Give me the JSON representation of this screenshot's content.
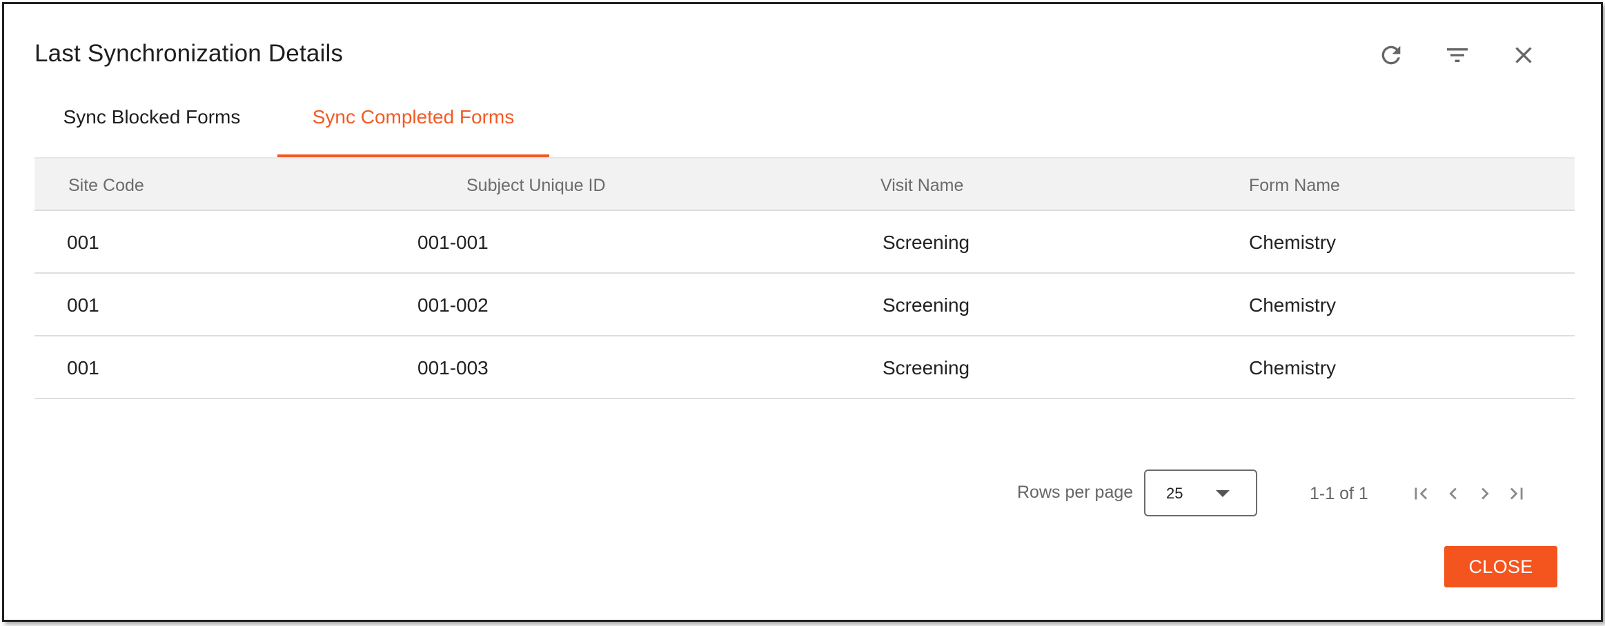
{
  "dialog": {
    "title": "Last Synchronization Details",
    "header_icons": [
      "refresh-icon",
      "filter-icon",
      "close-icon"
    ]
  },
  "tabs": [
    {
      "label": "Sync Blocked Forms",
      "active": false
    },
    {
      "label": "Sync Completed Forms",
      "active": true
    }
  ],
  "colors": {
    "accent": "#f25a24",
    "close_button": "#f4541e",
    "header_bg": "#f2f2f2"
  },
  "table": {
    "columns": [
      "Site Code",
      "Subject Unique ID",
      "Visit Name",
      "Form Name"
    ],
    "rows": [
      [
        "001",
        "001-001",
        "Screening",
        "Chemistry"
      ],
      [
        "001",
        "001-002",
        "Screening",
        "Chemistry"
      ],
      [
        "001",
        "001-003",
        "Screening",
        "Chemistry"
      ]
    ]
  },
  "pagination": {
    "rows_per_page_label": "Rows per page",
    "rows_per_page_value": "25",
    "range_text": "1-1 of 1",
    "icons": [
      "first-page-icon",
      "previous-page-icon",
      "next-page-icon",
      "last-page-icon"
    ]
  },
  "footer": {
    "close_label": "CLOSE"
  }
}
